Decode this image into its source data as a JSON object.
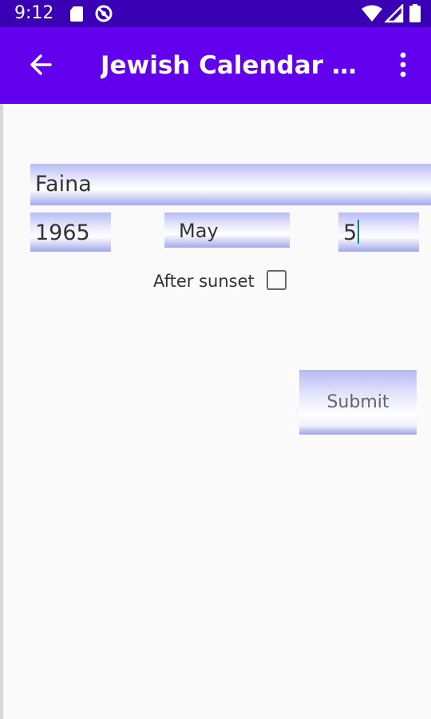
{
  "status_bar": {
    "time": "9:12",
    "icons": [
      "sd-card-icon",
      "do-not-disturb-icon",
      "wifi-icon",
      "signal-icon",
      "battery-icon"
    ],
    "background": "#3a00b3"
  },
  "app_bar": {
    "title": "Jewish Calendar Co...",
    "background": "#6200ee",
    "back_icon": "arrow-back-icon",
    "menu_icon": "more-vert-icon"
  },
  "form": {
    "name_value": "Faina",
    "year_value": "1965",
    "month_value": "May",
    "day_value": "5",
    "after_sunset_label": "After sunset",
    "after_sunset_checked": false,
    "submit_label": "Submit",
    "field_gradient_colors": [
      "#b8bcf2",
      "#ffffff",
      "#a3a8ea"
    ],
    "cursor_color": "#00897b"
  }
}
